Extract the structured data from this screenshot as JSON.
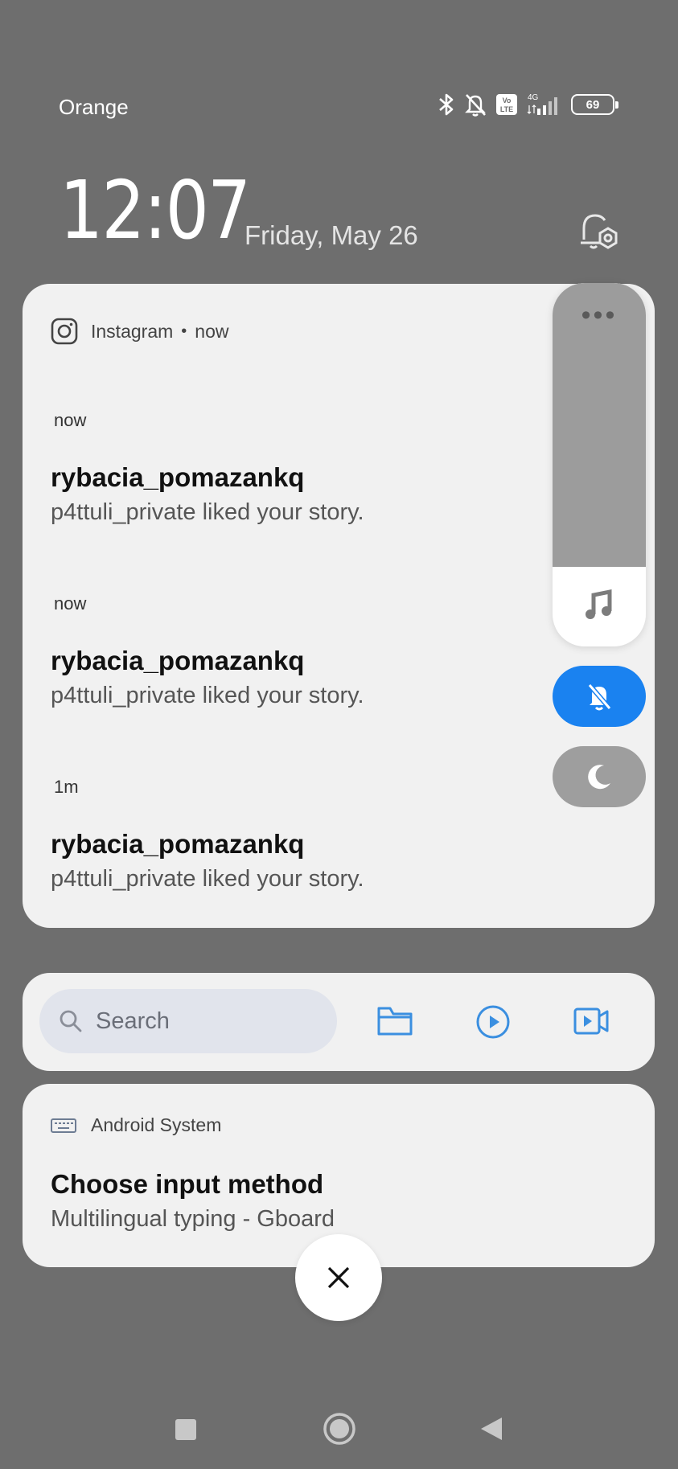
{
  "status_bar": {
    "carrier": "Orange",
    "network": "4G",
    "volte": "Vo LTE",
    "battery": "69"
  },
  "lockscreen": {
    "time": "12:07",
    "date": "Friday, May 26"
  },
  "instagram": {
    "app_name": "Instagram",
    "separator": "•",
    "time": "now",
    "notifications": [
      {
        "time": "now",
        "title": "rybacia_pomazankq",
        "body": "p4ttuli_private liked your story."
      },
      {
        "time": "now",
        "title": "rybacia_pomazankq",
        "body": "p4ttuli_private liked your story."
      },
      {
        "time": "1m",
        "title": "rybacia_pomazankq",
        "body": "p4ttuli_private liked your story."
      }
    ]
  },
  "volume_panel": {
    "level": 0.78,
    "more_label": "•••"
  },
  "search_card": {
    "placeholder": "Search"
  },
  "android_system": {
    "app_name": "Android System",
    "title": "Choose input method",
    "body": "Multilingual typing - Gboard"
  },
  "colors": {
    "background": "#6e6e6e",
    "card": "#f1f1f1",
    "accent": "#1a82f0",
    "quick_icon": "#3b8fe0"
  },
  "icons": {
    "status": [
      "bluetooth-icon",
      "muted-bell-icon",
      "volte-icon",
      "signal-icon",
      "battery-icon"
    ],
    "quick_actions": [
      "folder-icon",
      "play-icon",
      "video-icon"
    ]
  }
}
